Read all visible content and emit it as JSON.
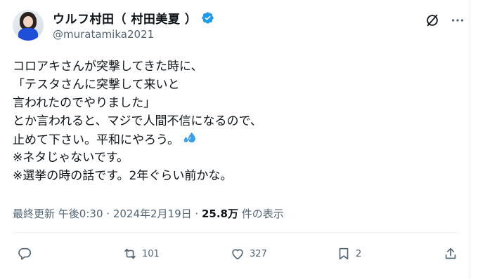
{
  "author": {
    "display_name": "ウルフ村田（ 村田美夏 ）",
    "handle": "@muratamika2021",
    "verified": true
  },
  "tweet": {
    "lines": [
      "コロアキさんが突撃してきた時に、",
      "「テスタさんに突撃して来いと",
      "言われたのでやりました」",
      "とか言われると、マジで人間不信になるので、",
      "止めて下さい。平和にやろう。",
      "※ネタじゃないです。",
      "※選挙の時の話です。2年ぐらい前かな。"
    ],
    "emoji": "sweat-droplets"
  },
  "meta": {
    "updated_label": "最終更新",
    "time": "午後0:30",
    "date": "2024年2月19日",
    "separator": "·",
    "views": "25.8万",
    "views_label": "件の表示"
  },
  "actions": {
    "reply_count": "",
    "repost_count": "101",
    "like_count": "327",
    "bookmark_count": "2"
  },
  "colors": {
    "text": "#0f1419",
    "secondary": "#536471",
    "verified": "#1d9bf0",
    "divider": "#eff3f4",
    "emoji": "#3aa0e8"
  },
  "icons": [
    "verified-badge-icon",
    "grok-icon",
    "more-icon",
    "reply-icon",
    "repost-icon",
    "like-icon",
    "bookmark-icon",
    "share-icon"
  ]
}
